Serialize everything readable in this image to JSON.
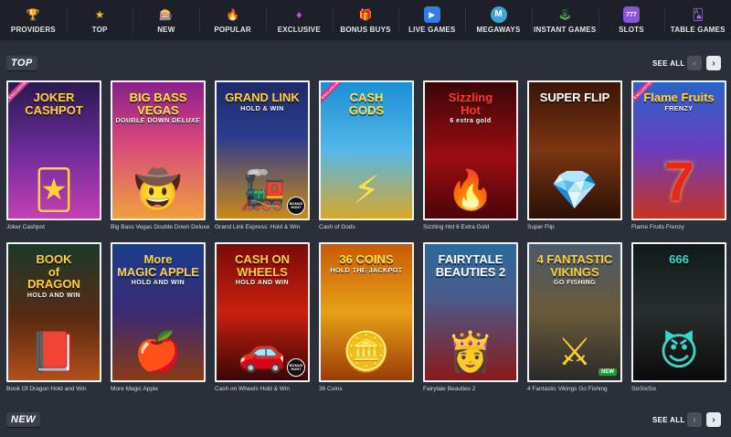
{
  "nav": [
    {
      "label": "PROVIDERS",
      "icon": "trophy-icon",
      "glyph": "🏆",
      "color": "#c99b56"
    },
    {
      "label": "TOP",
      "icon": "star-icon",
      "glyph": "★",
      "color": "#f2c200"
    },
    {
      "label": "NEW",
      "icon": "new-game-icon",
      "glyph": "🎰",
      "color": "#56a7d9"
    },
    {
      "label": "POPULAR",
      "icon": "fire-icon",
      "glyph": "🔥",
      "color": "#f07a2a"
    },
    {
      "label": "EXCLUSIVE",
      "icon": "diamond-icon",
      "glyph": "♦",
      "color": "#c850e8"
    },
    {
      "label": "BONUS BUYS",
      "icon": "gift-icon",
      "glyph": "🎁",
      "color": "#3fb6e8"
    },
    {
      "label": "LIVE GAMES",
      "icon": "play-icon",
      "glyph": "▶",
      "color": "#2f7ee8"
    },
    {
      "label": "MEGAWAYS",
      "icon": "megaways-icon",
      "glyph": "M",
      "color": "#3aa6d8"
    },
    {
      "label": "INSTANT GAMES",
      "icon": "joystick-icon",
      "glyph": "🕹",
      "color": "#48b04a"
    },
    {
      "label": "SLOTS",
      "icon": "slot-machine-icon",
      "glyph": "777",
      "color": "#8a54d6"
    },
    {
      "label": "TABLE GAMES",
      "icon": "cards-icon",
      "glyph": "🂡",
      "color": "#a66fe0"
    }
  ],
  "sections": {
    "top": {
      "title": "TOP",
      "see_all": "SEE ALL",
      "prev": "‹",
      "next": "›"
    },
    "new": {
      "title": "NEW",
      "see_all": "SEE ALL",
      "prev": "‹",
      "next": "›"
    }
  },
  "games_row1": [
    {
      "name": "Joker Cashpot",
      "art_title": "JOKER\nCASHPOT",
      "art_sub": "",
      "ribbon": "EXCLUSIVE",
      "badge": "",
      "bg": "linear-gradient(180deg,#2a1950 0%,#6b2b9a 50%,#c43fb3 100%)",
      "title_color": "#ffd23a",
      "glyph": "🃏"
    },
    {
      "name": "Big Bass Vegas Double Down Deluxe",
      "art_title": "BIG BASS\nVEGAS",
      "art_sub": "DOUBLE DOWN DELUXE",
      "ribbon": "",
      "badge": "",
      "bg": "linear-gradient(180deg,#8a1f8a 0%,#d8487a 45%,#f0a040 100%)",
      "title_color": "#ffe04a",
      "glyph": "🤠"
    },
    {
      "name": "Grand Link Express: Hold & Win",
      "art_title": "GRAND LINK",
      "art_sub": "HOLD & WIN",
      "ribbon": "",
      "badge": "hunt",
      "bg": "linear-gradient(180deg,#1c2a6a 0%,#2e3c8e 40%,#c98a16 100%)",
      "title_color": "#ffcf3a",
      "glyph": "🚂"
    },
    {
      "name": "Cash of Gods",
      "art_title": "CASH\nGODS",
      "art_sub": "",
      "ribbon": "EXCLUSIVE",
      "badge": "",
      "bg": "linear-gradient(180deg,#1b8fd6 0%,#53b8e8 50%,#d9a62a 100%)",
      "title_color": "#ffe04a",
      "glyph": "⚡"
    },
    {
      "name": "Sizzling Hot 6 Extra Gold",
      "art_title": "Sizzling\nHot",
      "art_sub": "6 extra gold",
      "ribbon": "",
      "badge": "",
      "bg": "linear-gradient(180deg,#3a0508 0%,#9c0d12 55%,#4a0508 100%)",
      "title_color": "#ff3a2e",
      "glyph": "🔥"
    },
    {
      "name": "Super Flip",
      "art_title": "SUPER FLIP",
      "art_sub": "",
      "ribbon": "",
      "badge": "",
      "bg": "linear-gradient(180deg,#3a1506 0%,#7a3610 50%,#2a1006 100%)",
      "title_color": "#ffffff",
      "glyph": "💎"
    },
    {
      "name": "Flame Fruits Frenzy",
      "art_title": "Flame Fruits",
      "art_sub": "FRENZY",
      "ribbon": "EXCLUSIVE",
      "badge": "",
      "bg": "linear-gradient(180deg,#2a64c8 0%,#6a3dbe 50%,#c8331e 100%)",
      "title_color": "#ffd23a",
      "glyph": "7"
    }
  ],
  "games_row2": [
    {
      "name": "Book Of Dragon Hold and Win",
      "art_title": "BOOK\nof\nDRAGON",
      "art_sub": "HOLD AND WIN",
      "ribbon": "",
      "badge": "",
      "bg": "linear-gradient(180deg,#1a3a2a 0%,#5a2a12 55%,#b0501a 100%)",
      "title_color": "#ffcf3a",
      "glyph": "📕"
    },
    {
      "name": "More Magic Apple",
      "art_title": "More\nMAGIC APPLE",
      "art_sub": "HOLD AND WIN",
      "ribbon": "",
      "badge": "",
      "bg": "linear-gradient(180deg,#1a3e8a 0%,#3a2a72 50%,#8a3a14 100%)",
      "title_color": "#ffd23a",
      "glyph": "🍎"
    },
    {
      "name": "Cash on Wheels Hold & Win",
      "art_title": "CASH ON WHEELS",
      "art_sub": "HOLD AND WIN",
      "ribbon": "",
      "badge": "hunt",
      "bg": "linear-gradient(180deg,#7a0a0a 0%,#c8200e 50%,#3a0606 100%)",
      "title_color": "#ffcf3a",
      "glyph": "🚗"
    },
    {
      "name": "36 Coins",
      "art_title": "36 COINS",
      "art_sub": "HOLD THE JACKPOT",
      "ribbon": "",
      "badge": "",
      "bg": "linear-gradient(180deg,#c85a06 0%,#e8a018 50%,#9a3c06 100%)",
      "title_color": "#ffe04a",
      "glyph": "🪙"
    },
    {
      "name": "Fairytale Beauties 2",
      "art_title": "FAIRYTALE\nBEAUTIES 2",
      "art_sub": "",
      "ribbon": "",
      "badge": "",
      "bg": "linear-gradient(180deg,#2a6a9a 0%,#4a5a8a 40%,#8a1a1a 100%)",
      "title_color": "#ffffff",
      "glyph": "👸"
    },
    {
      "name": "4 Fantastic Vikings Go Fishing",
      "art_title": "4 FANTASTIC\nVIKINGS",
      "art_sub": "GO FISHING",
      "ribbon": "",
      "badge": "NEW",
      "bg": "linear-gradient(180deg,#4a5a6a 0%,#6a5a3a 50%,#2a2a2a 100%)",
      "title_color": "#ffcf3a",
      "glyph": "⚔"
    },
    {
      "name": "SixSixSix",
      "art_title": "666",
      "art_sub": "",
      "ribbon": "",
      "badge": "",
      "bg": "linear-gradient(180deg,#0e1a1a 0%,#2a2e2e 50%,#0a0a0a 100%)",
      "title_color": "#3ad6c8",
      "glyph": "😈"
    }
  ],
  "hunt_badge_text": "BONUS HUNT"
}
